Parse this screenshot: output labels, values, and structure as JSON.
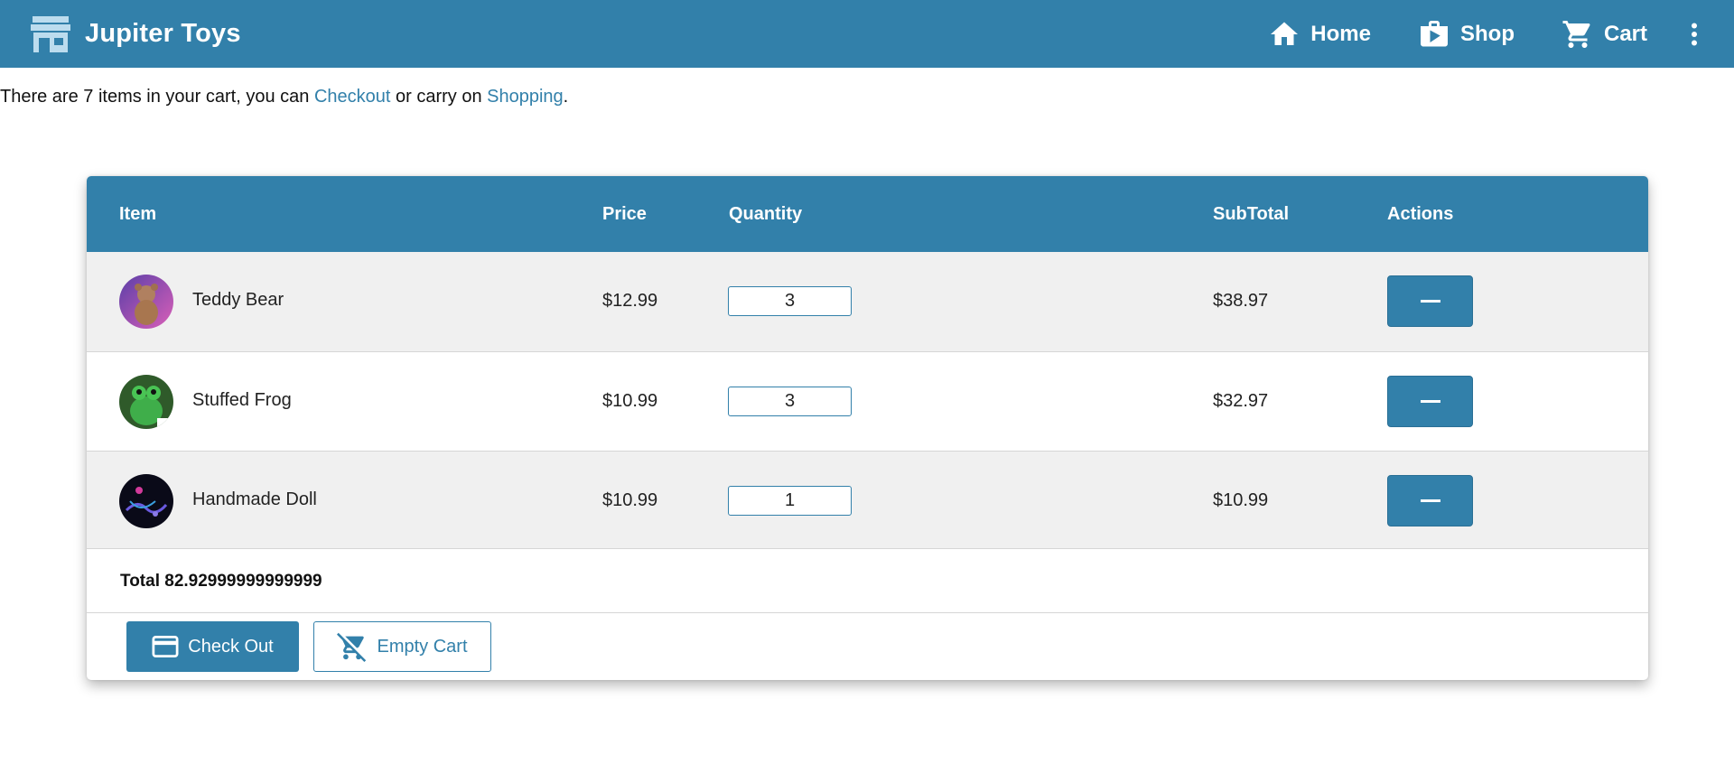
{
  "app": {
    "brand": "Jupiter Toys",
    "nav": {
      "home": "Home",
      "shop": "Shop",
      "cart": "Cart"
    }
  },
  "intro": {
    "prefix": "There are 7 items in your cart, you can ",
    "checkout_link": "Checkout",
    "middle": " or carry on ",
    "shopping_link": "Shopping",
    "suffix": "."
  },
  "table": {
    "headers": {
      "item": "Item",
      "price": "Price",
      "quantity": "Quantity",
      "subtotal": "SubTotal",
      "actions": "Actions"
    },
    "rows": [
      {
        "name": "Teddy Bear",
        "price": "$12.99",
        "quantity": "3",
        "subtotal": "$38.97",
        "image": "teddy-bear-thumbnail"
      },
      {
        "name": "Stuffed Frog",
        "price": "$10.99",
        "quantity": "3",
        "subtotal": "$32.97",
        "image": "stuffed-frog-thumbnail"
      },
      {
        "name": "Handmade Doll",
        "price": "$10.99",
        "quantity": "1",
        "subtotal": "$10.99",
        "image": "handmade-doll-thumbnail"
      }
    ]
  },
  "total": "Total 82.92999999999999",
  "buttons": {
    "checkout": "Check Out",
    "empty_cart": "Empty Cart"
  },
  "colors": {
    "primary": "#3280aa",
    "row_alt": "#f0f0f0"
  },
  "icons": [
    "store-icon",
    "home-icon",
    "shop-icon",
    "cart-icon",
    "more-vert-icon",
    "remove-icon",
    "credit-card-icon",
    "remove-shopping-cart-icon"
  ]
}
